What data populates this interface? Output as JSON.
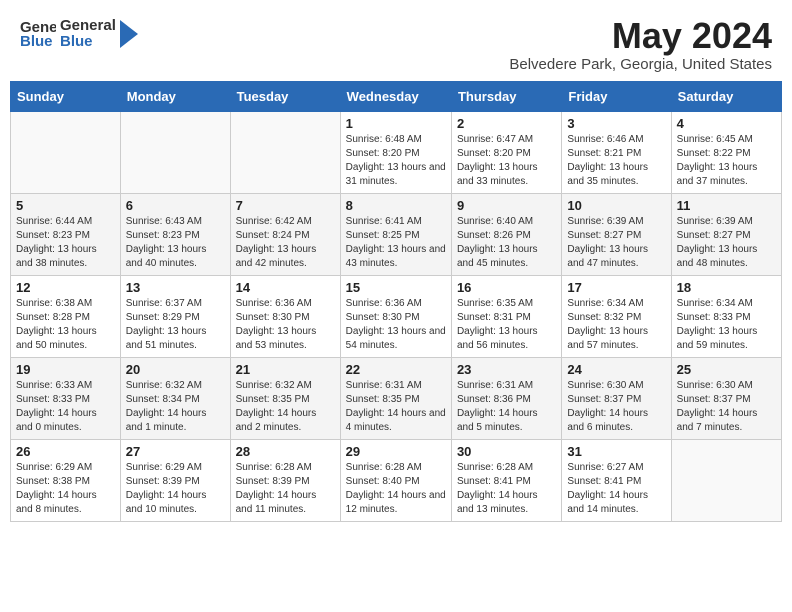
{
  "header": {
    "logo_general": "General",
    "logo_blue": "Blue",
    "month_title": "May 2024",
    "subtitle": "Belvedere Park, Georgia, United States"
  },
  "days_of_week": [
    "Sunday",
    "Monday",
    "Tuesday",
    "Wednesday",
    "Thursday",
    "Friday",
    "Saturday"
  ],
  "weeks": [
    [
      {
        "day": "",
        "info": ""
      },
      {
        "day": "",
        "info": ""
      },
      {
        "day": "",
        "info": ""
      },
      {
        "day": "1",
        "info": "Sunrise: 6:48 AM\nSunset: 8:20 PM\nDaylight: 13 hours\nand 31 minutes."
      },
      {
        "day": "2",
        "info": "Sunrise: 6:47 AM\nSunset: 8:20 PM\nDaylight: 13 hours\nand 33 minutes."
      },
      {
        "day": "3",
        "info": "Sunrise: 6:46 AM\nSunset: 8:21 PM\nDaylight: 13 hours\nand 35 minutes."
      },
      {
        "day": "4",
        "info": "Sunrise: 6:45 AM\nSunset: 8:22 PM\nDaylight: 13 hours\nand 37 minutes."
      }
    ],
    [
      {
        "day": "5",
        "info": "Sunrise: 6:44 AM\nSunset: 8:23 PM\nDaylight: 13 hours\nand 38 minutes."
      },
      {
        "day": "6",
        "info": "Sunrise: 6:43 AM\nSunset: 8:23 PM\nDaylight: 13 hours\nand 40 minutes."
      },
      {
        "day": "7",
        "info": "Sunrise: 6:42 AM\nSunset: 8:24 PM\nDaylight: 13 hours\nand 42 minutes."
      },
      {
        "day": "8",
        "info": "Sunrise: 6:41 AM\nSunset: 8:25 PM\nDaylight: 13 hours\nand 43 minutes."
      },
      {
        "day": "9",
        "info": "Sunrise: 6:40 AM\nSunset: 8:26 PM\nDaylight: 13 hours\nand 45 minutes."
      },
      {
        "day": "10",
        "info": "Sunrise: 6:39 AM\nSunset: 8:27 PM\nDaylight: 13 hours\nand 47 minutes."
      },
      {
        "day": "11",
        "info": "Sunrise: 6:39 AM\nSunset: 8:27 PM\nDaylight: 13 hours\nand 48 minutes."
      }
    ],
    [
      {
        "day": "12",
        "info": "Sunrise: 6:38 AM\nSunset: 8:28 PM\nDaylight: 13 hours\nand 50 minutes."
      },
      {
        "day": "13",
        "info": "Sunrise: 6:37 AM\nSunset: 8:29 PM\nDaylight: 13 hours\nand 51 minutes."
      },
      {
        "day": "14",
        "info": "Sunrise: 6:36 AM\nSunset: 8:30 PM\nDaylight: 13 hours\nand 53 minutes."
      },
      {
        "day": "15",
        "info": "Sunrise: 6:36 AM\nSunset: 8:30 PM\nDaylight: 13 hours\nand 54 minutes."
      },
      {
        "day": "16",
        "info": "Sunrise: 6:35 AM\nSunset: 8:31 PM\nDaylight: 13 hours\nand 56 minutes."
      },
      {
        "day": "17",
        "info": "Sunrise: 6:34 AM\nSunset: 8:32 PM\nDaylight: 13 hours\nand 57 minutes."
      },
      {
        "day": "18",
        "info": "Sunrise: 6:34 AM\nSunset: 8:33 PM\nDaylight: 13 hours\nand 59 minutes."
      }
    ],
    [
      {
        "day": "19",
        "info": "Sunrise: 6:33 AM\nSunset: 8:33 PM\nDaylight: 14 hours\nand 0 minutes."
      },
      {
        "day": "20",
        "info": "Sunrise: 6:32 AM\nSunset: 8:34 PM\nDaylight: 14 hours\nand 1 minute."
      },
      {
        "day": "21",
        "info": "Sunrise: 6:32 AM\nSunset: 8:35 PM\nDaylight: 14 hours\nand 2 minutes."
      },
      {
        "day": "22",
        "info": "Sunrise: 6:31 AM\nSunset: 8:35 PM\nDaylight: 14 hours\nand 4 minutes."
      },
      {
        "day": "23",
        "info": "Sunrise: 6:31 AM\nSunset: 8:36 PM\nDaylight: 14 hours\nand 5 minutes."
      },
      {
        "day": "24",
        "info": "Sunrise: 6:30 AM\nSunset: 8:37 PM\nDaylight: 14 hours\nand 6 minutes."
      },
      {
        "day": "25",
        "info": "Sunrise: 6:30 AM\nSunset: 8:37 PM\nDaylight: 14 hours\nand 7 minutes."
      }
    ],
    [
      {
        "day": "26",
        "info": "Sunrise: 6:29 AM\nSunset: 8:38 PM\nDaylight: 14 hours\nand 8 minutes."
      },
      {
        "day": "27",
        "info": "Sunrise: 6:29 AM\nSunset: 8:39 PM\nDaylight: 14 hours\nand 10 minutes."
      },
      {
        "day": "28",
        "info": "Sunrise: 6:28 AM\nSunset: 8:39 PM\nDaylight: 14 hours\nand 11 minutes."
      },
      {
        "day": "29",
        "info": "Sunrise: 6:28 AM\nSunset: 8:40 PM\nDaylight: 14 hours\nand 12 minutes."
      },
      {
        "day": "30",
        "info": "Sunrise: 6:28 AM\nSunset: 8:41 PM\nDaylight: 14 hours\nand 13 minutes."
      },
      {
        "day": "31",
        "info": "Sunrise: 6:27 AM\nSunset: 8:41 PM\nDaylight: 14 hours\nand 14 minutes."
      },
      {
        "day": "",
        "info": ""
      }
    ]
  ]
}
